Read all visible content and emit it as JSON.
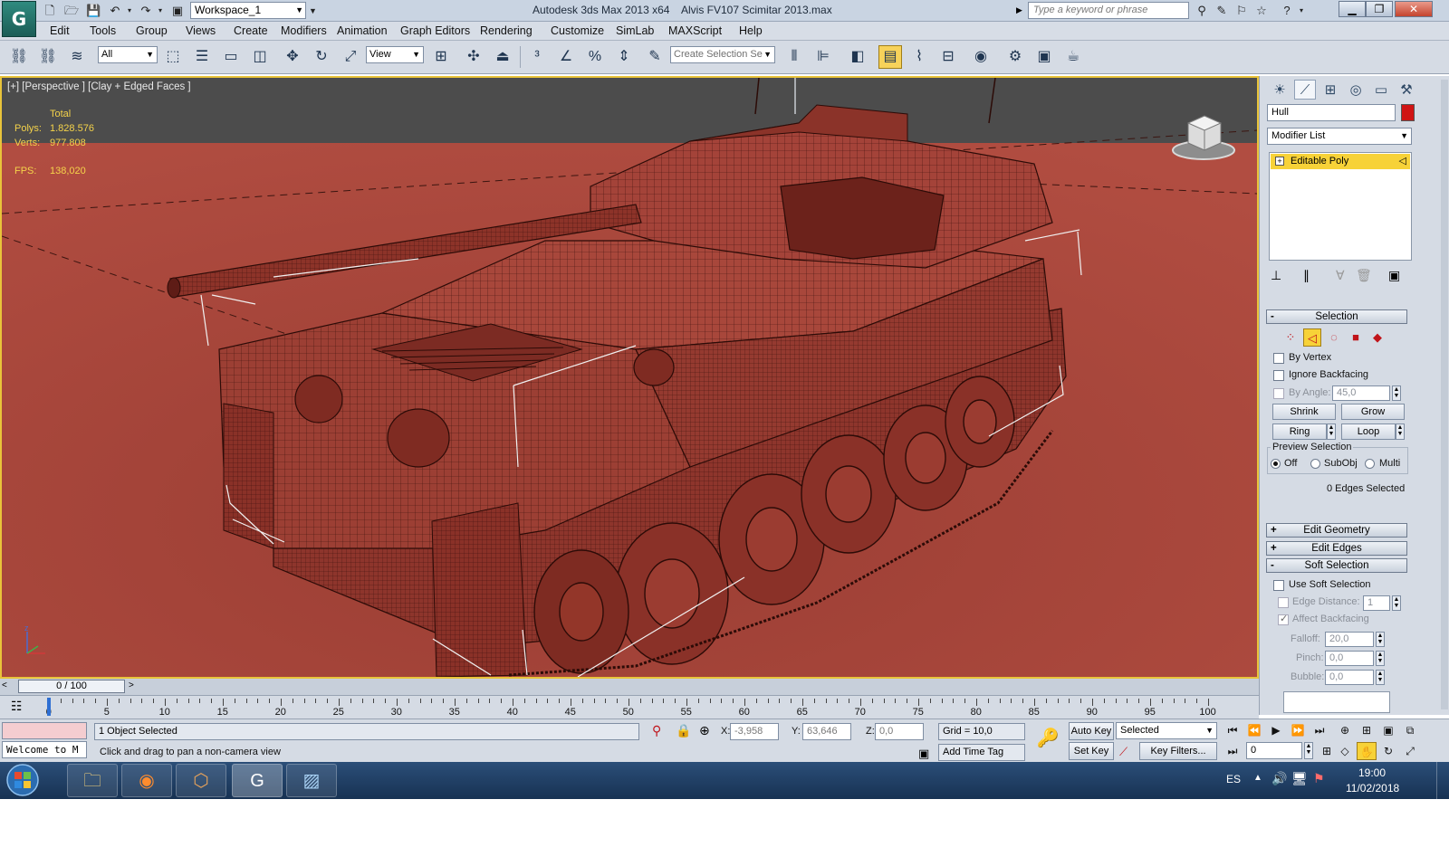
{
  "title": {
    "app": "Autodesk 3ds Max  2013 x64",
    "file": "Alvis FV107 Scimitar 2013.max",
    "workspace": "Workspace_1",
    "search_placeholder": "Type a keyword or phrase"
  },
  "menu": [
    "Edit",
    "Tools",
    "Group",
    "Views",
    "Create",
    "Modifiers",
    "Animation",
    "Graph Editors",
    "Rendering",
    "Customize",
    "SimLab",
    "MAXScript",
    "Help"
  ],
  "toolbar": {
    "selection_filter": "All",
    "ref_coord": "View",
    "named_selection_placeholder": "Create Selection Se"
  },
  "viewport": {
    "label": "[+] [Perspective ] [Clay + Edged Faces ]",
    "stats": {
      "total_label": "Total",
      "polys_label": "Polys:",
      "polys": "1.828.576",
      "verts_label": "Verts:",
      "verts": "977.808",
      "fps_label": "FPS:",
      "fps": "138,020"
    },
    "colors": {
      "background": "#a9473c",
      "sky": "#4e4e4e",
      "wire": "#3a0f0b",
      "stats": "#f5d34a"
    }
  },
  "command_panel": {
    "object_name": "Hull",
    "object_color": "#d01414",
    "modifier_list": "Modifier List",
    "stack_item": "Editable Poly",
    "selection": {
      "title": "Selection",
      "by_vertex": "By Vertex",
      "ignore_backfacing": "Ignore Backfacing",
      "by_angle": "By Angle:",
      "angle_value": "45,0",
      "shrink": "Shrink",
      "grow": "Grow",
      "ring": "Ring",
      "loop": "Loop",
      "preview_selection": "Preview Selection",
      "off": "Off",
      "subobj": "SubObj",
      "multi": "Multi",
      "status": "0 Edges Selected"
    },
    "rollouts": {
      "edit_geometry": "Edit Geometry",
      "edit_edges": "Edit Edges",
      "soft_selection": "Soft Selection"
    },
    "soft_selection": {
      "use_soft_selection": "Use Soft Selection",
      "edge_distance": "Edge Distance:",
      "edge_distance_value": "1",
      "affect_backfacing": "Affect Backfacing",
      "falloff": "Falloff:",
      "falloff_value": "20,0",
      "pinch": "Pinch:",
      "pinch_value": "0,0",
      "bubble": "Bubble:",
      "bubble_value": "0,0"
    }
  },
  "timeline": {
    "frame": "0 / 100",
    "ticks": [
      "0",
      "5",
      "10",
      "15",
      "20",
      "25",
      "30",
      "35",
      "40",
      "45",
      "50",
      "55",
      "60",
      "65",
      "70",
      "75",
      "80",
      "85",
      "90",
      "95",
      "100"
    ]
  },
  "status": {
    "listener": "Welcome to M",
    "selected": "1 Object Selected",
    "prompt": "Click and drag to pan a non-camera view",
    "x_label": "X:",
    "x": "-3,958",
    "y_label": "Y:",
    "y": "63,646",
    "z_label": "Z:",
    "z": "0,0",
    "grid": "Grid = 10,0",
    "add_time_tag": "Add Time Tag",
    "auto_key": "Auto Key",
    "set_key": "Set Key",
    "selected_dd": "Selected",
    "key_filters": "Key Filters...",
    "current_frame": "0"
  },
  "taskbar": {
    "lang": "ES",
    "time": "19:00",
    "date": "11/02/2018"
  }
}
